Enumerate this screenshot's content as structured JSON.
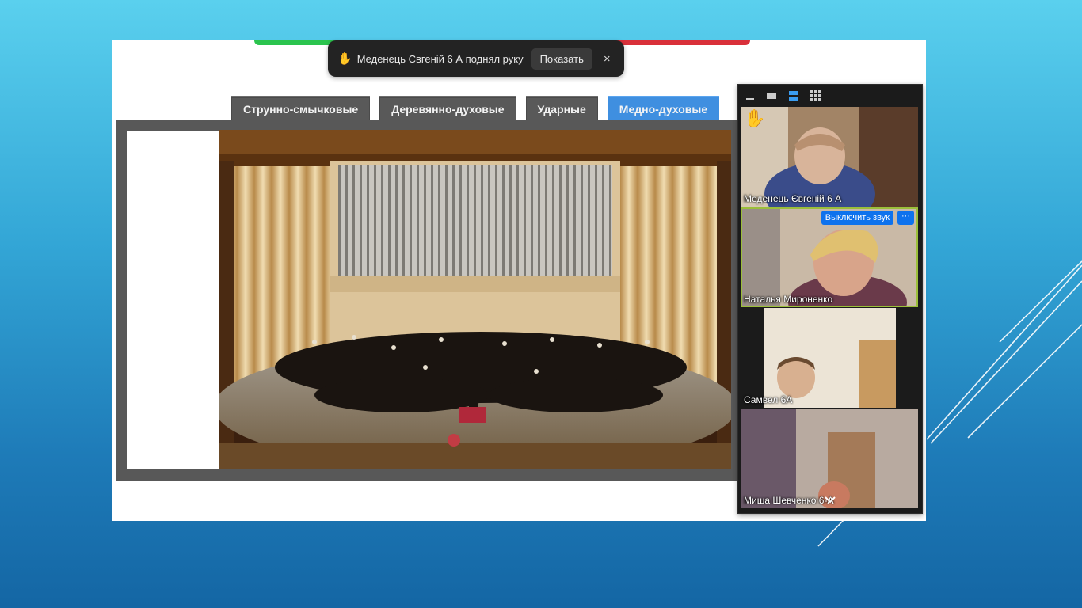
{
  "notification": {
    "hand_icon": "raised-hand-icon",
    "message": "Меденець Євгеній 6 А поднял руку",
    "show_label": "Показать",
    "close_label": "×"
  },
  "tabs": [
    {
      "label": "Струнно-смычковые",
      "active": false
    },
    {
      "label": "Деревянно-духовые",
      "active": false
    },
    {
      "label": "Ударные",
      "active": false
    },
    {
      "label": "Медно-духовые",
      "active": true
    }
  ],
  "panel": {
    "view_icons": [
      "minimize-icon",
      "single-view-icon",
      "strip-view-icon",
      "gallery-view-icon"
    ],
    "participants": [
      {
        "name": "Меденець Євгеній 6 А",
        "hand_raised": true
      },
      {
        "name": "Наталья Мироненко",
        "active_speaker": true,
        "unmute_label": "Выключить звук",
        "more_label": "···"
      },
      {
        "name": "Самвел 6А"
      },
      {
        "name": "Миша Шевченко 6-А"
      }
    ],
    "scroll_icon": "chevron-down-icon"
  },
  "colors": {
    "active_tab": "#3f8fe0",
    "tab": "#595959",
    "zoom_blue": "#0e72ed",
    "speaker_outline": "#9bbf3a"
  }
}
